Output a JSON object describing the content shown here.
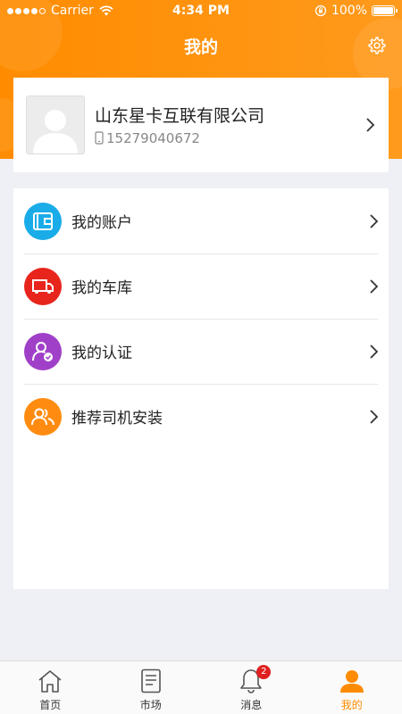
{
  "status_bar": {
    "carrier": "Carrier",
    "time": "4:34 PM",
    "battery": "100%"
  },
  "nav": {
    "title": "我的"
  },
  "profile": {
    "company": "山东星卡互联有限公司",
    "phone": "15279040672"
  },
  "menu": [
    {
      "label": "我的账户",
      "icon": "wallet-icon",
      "color": "#1aace8"
    },
    {
      "label": "我的车库",
      "icon": "truck-icon",
      "color": "#e8251c"
    },
    {
      "label": "我的认证",
      "icon": "verified-user-icon",
      "color": "#a040c8"
    },
    {
      "label": "推荐司机安装",
      "icon": "users-icon",
      "color": "#ff8c10"
    }
  ],
  "tabs": [
    {
      "label": "首页",
      "icon": "home-icon"
    },
    {
      "label": "市场",
      "icon": "list-icon"
    },
    {
      "label": "消息",
      "icon": "bell-icon",
      "badge": "2"
    },
    {
      "label": "我的",
      "icon": "person-icon",
      "active": true
    }
  ],
  "colors": {
    "accent": "#ff8c00",
    "background": "#eef0f5"
  }
}
